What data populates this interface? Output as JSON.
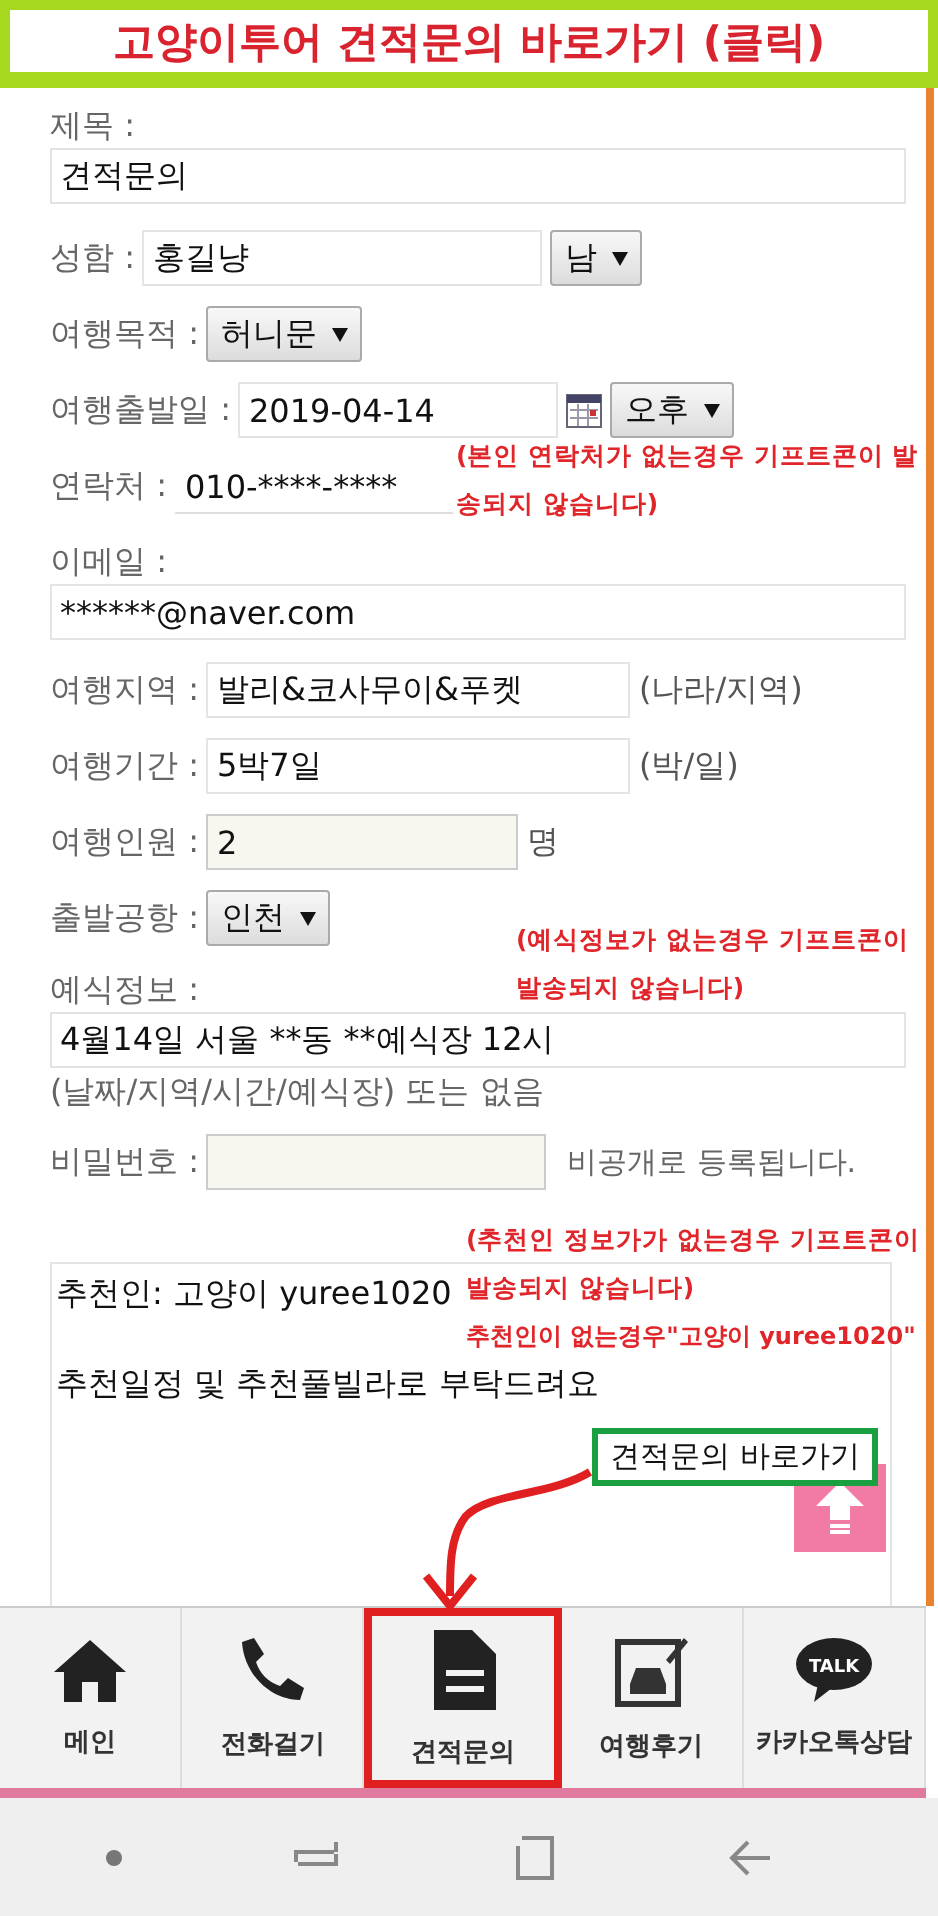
{
  "banner": {
    "title": "고양이투어 견적문의 바로가기 (클릭)"
  },
  "subject": {
    "label": "제목 :",
    "value": "견적문의"
  },
  "name": {
    "label": "성함 :",
    "value": "홍길냥",
    "gender": "남"
  },
  "purpose": {
    "label": "여행목적 :",
    "value": "허니문"
  },
  "departure_date": {
    "label": "여행출발일 :",
    "value": "2019-04-14",
    "period": "오후"
  },
  "contact": {
    "label": "연락처 :",
    "value": "010-****-****",
    "note": "(본인 연락처가 없는경우 기프트콘이 발송되지 않습니다)"
  },
  "email": {
    "label": "이메일 :",
    "value": "******@naver.com"
  },
  "region": {
    "label": "여행지역 :",
    "value": "발리&코사무이&푸켓",
    "unit": "(나라/지역)"
  },
  "duration": {
    "label": "여행기간 :",
    "value": "5박7일",
    "unit": "(박/일)"
  },
  "people": {
    "label": "여행인원 :",
    "value": "2",
    "unit": "명"
  },
  "airport": {
    "label": "출발공항 :",
    "value": "인천"
  },
  "wedding": {
    "label": "예식정보 :",
    "value": "4월14일 서울 **동 **예식장 12시",
    "hint": "(날짜/지역/시간/예식장) 또는 없음",
    "note": "(예식정보가 없는경우 기프트콘이 발송되지 않습니다)"
  },
  "password": {
    "label": "비밀번호 :",
    "suffix": "비공개로 등록됩니다."
  },
  "message": {
    "lines": [
      "추천인: 고양이 yuree1020",
      "추천일정 및 추천풀빌라로 부탁드려요"
    ],
    "note": "(추천인 정보가가 없는경우 기프트콘이 발송되지 않습니다)",
    "default_note": "추천인이 없는경우\"고양이 yuree1020\""
  },
  "callout": {
    "label": "견적문의 바로가기"
  },
  "nav": [
    {
      "label": "메인",
      "highlighted": false
    },
    {
      "label": "전화걸기",
      "highlighted": false
    },
    {
      "label": "견적문의",
      "highlighted": true
    },
    {
      "label": "여행후기",
      "highlighted": false
    },
    {
      "label": "카카오톡상담",
      "highlighted": false,
      "icon_text": "TALK"
    }
  ]
}
